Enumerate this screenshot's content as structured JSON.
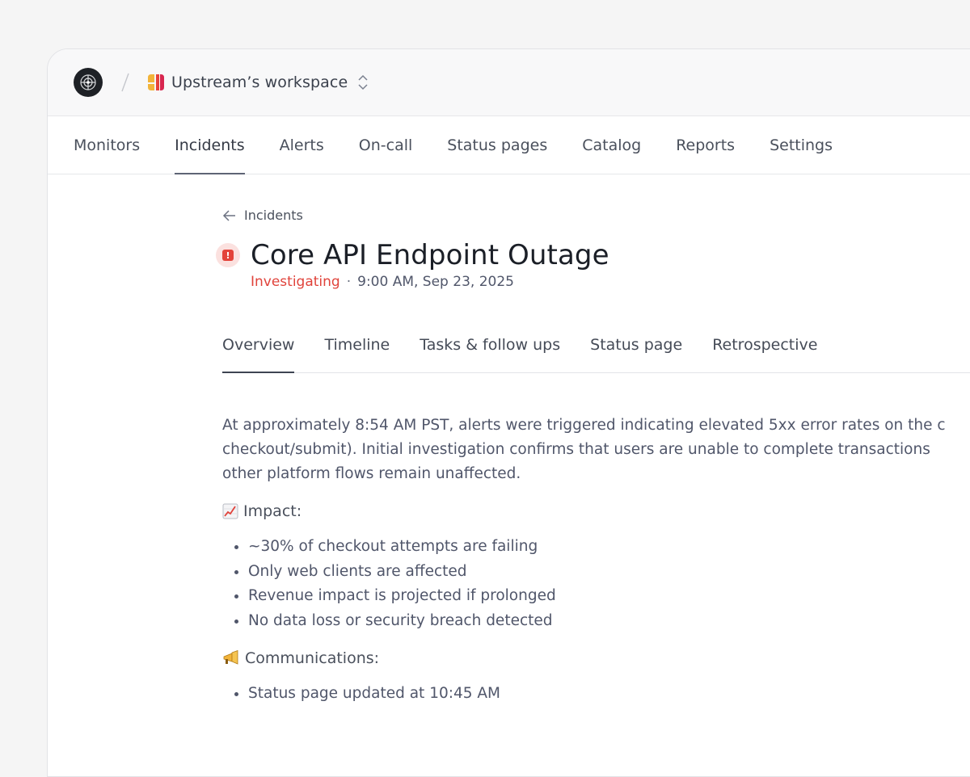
{
  "header": {
    "workspace_name": "Upstream’s workspace",
    "separator": "/"
  },
  "nav": {
    "items": [
      {
        "label": "Monitors"
      },
      {
        "label": "Incidents"
      },
      {
        "label": "Alerts"
      },
      {
        "label": "On-call"
      },
      {
        "label": "Status pages"
      },
      {
        "label": "Catalog"
      },
      {
        "label": "Reports"
      },
      {
        "label": "Settings"
      }
    ],
    "active": "Incidents"
  },
  "incident": {
    "back_label": "Incidents",
    "title": "Core API Endpoint Outage",
    "status": "Investigating",
    "meta_separator": "·",
    "timestamp": "9:00 AM, Sep 23, 2025",
    "status_color": "#e0433b"
  },
  "tabs": {
    "items": [
      {
        "label": "Overview"
      },
      {
        "label": "Timeline"
      },
      {
        "label": "Tasks & follow ups"
      },
      {
        "label": "Status page"
      },
      {
        "label": "Retrospective"
      }
    ],
    "active": "Overview"
  },
  "overview": {
    "summary_lines": [
      "At approximately 8:54 AM PST, alerts were triggered indicating elevated 5xx error rates on the c",
      "checkout/submit). Initial investigation confirms that users are unable to complete transactions",
      "other platform flows remain unaffected."
    ],
    "impact": {
      "icon": "chart-increasing-icon",
      "heading": "Impact:",
      "items": [
        "~30% of checkout attempts are failing",
        "Only web clients are affected",
        "Revenue impact is projected if prolonged",
        "No data loss or security breach detected"
      ]
    },
    "communications": {
      "icon": "megaphone-icon",
      "heading": "Communications:",
      "items": [
        "Status page updated at 10:45 AM"
      ]
    }
  }
}
